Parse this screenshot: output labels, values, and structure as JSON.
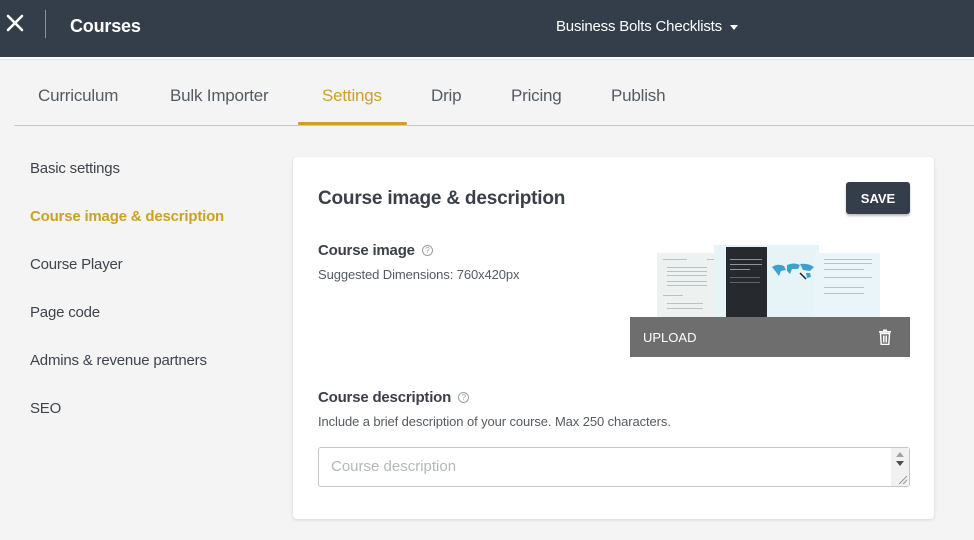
{
  "topbar": {
    "close_icon": "close-icon",
    "title": "Courses",
    "school_name": "Business Bolts Checklists",
    "school_caret_icon": "caret-down-icon"
  },
  "tabs": [
    {
      "label": "Curriculum",
      "active": false
    },
    {
      "label": "Bulk Importer",
      "active": false
    },
    {
      "label": "Settings",
      "active": true
    },
    {
      "label": "Drip",
      "active": false
    },
    {
      "label": "Pricing",
      "active": false
    },
    {
      "label": "Publish",
      "active": false
    }
  ],
  "sidenav": {
    "items": [
      {
        "label": "Basic settings",
        "active": false
      },
      {
        "label": "Course image & description",
        "active": true
      },
      {
        "label": "Course Player",
        "active": false
      },
      {
        "label": "Page code",
        "active": false
      },
      {
        "label": "Admins & revenue partners",
        "active": false
      },
      {
        "label": "SEO",
        "active": false
      }
    ]
  },
  "card": {
    "title": "Course image & description",
    "save_label": "SAVE",
    "course_image": {
      "label": "Course image",
      "help_icon": "question-circle-icon",
      "hint": "Suggested Dimensions: 760x420px",
      "upload_label": "UPLOAD",
      "delete_icon": "trash-icon"
    },
    "course_description": {
      "label": "Course description",
      "help_icon": "question-circle-icon",
      "hint": "Include a brief description of your course. Max 250 characters.",
      "placeholder": "Course description",
      "value": ""
    }
  },
  "colors": {
    "topbar_bg": "#343d4a",
    "accent": "#c9a227",
    "page_bg": "#f4f4f4",
    "upload_bar_bg": "#6e6e6e"
  }
}
